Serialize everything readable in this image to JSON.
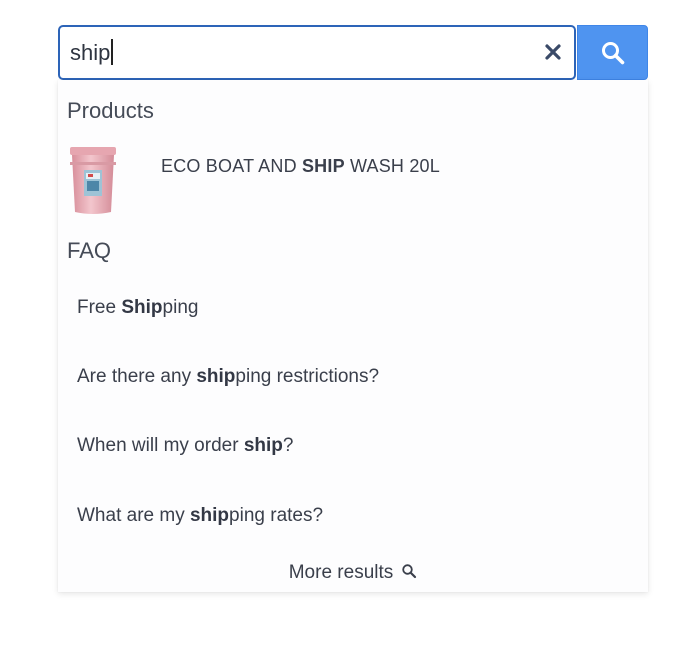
{
  "search": {
    "value": "ship",
    "clear_icon": "close-icon",
    "submit_icon": "search-icon",
    "accent_color": "#4f94f0",
    "border_color": "#2d64b8"
  },
  "products": {
    "heading": "Products",
    "items": [
      {
        "name_parts": [
          "ECO BOAT AND ",
          "SHIP",
          " WASH 20L"
        ],
        "thumbnail": "pink-bucket-image"
      }
    ]
  },
  "faq": {
    "heading": "FAQ",
    "items": [
      {
        "parts": [
          "Free ",
          "Ship",
          "ping"
        ]
      },
      {
        "parts": [
          "Are there any ",
          "ship",
          "ping restrictions?"
        ]
      },
      {
        "parts": [
          "When will my order ",
          "ship",
          "?"
        ]
      },
      {
        "parts": [
          "What are my ",
          "ship",
          "ping rates?"
        ]
      }
    ]
  },
  "more_results": {
    "label": "More results",
    "icon": "search-icon"
  }
}
